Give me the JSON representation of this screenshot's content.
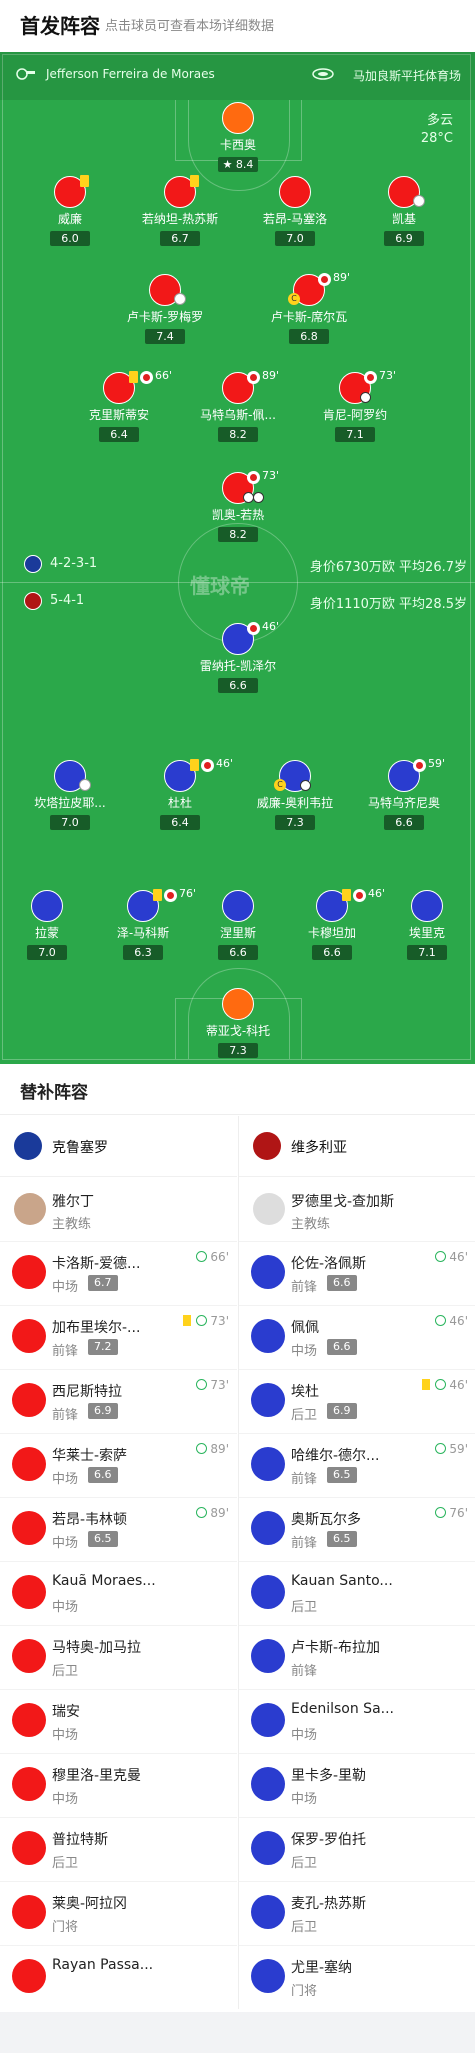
{
  "header": {
    "title": "首发阵容",
    "subtitle": "点击球员可查看本场详细数据"
  },
  "pitch": {
    "referee": "Jefferson Ferreira de Moraes",
    "venue": "马加良斯平托体育场",
    "weather": "多云",
    "temperature": "28°C",
    "watermark": "懂球帝"
  },
  "home_lineup": {
    "gk": {
      "name": "卡西奥",
      "rating": "8.4"
    },
    "def": [
      {
        "name": "威廉",
        "rating": "6.0"
      },
      {
        "name": "若纳坦-热苏斯",
        "rating": "6.7"
      },
      {
        "name": "若昂-马塞洛",
        "rating": "7.0"
      },
      {
        "name": "凯基",
        "rating": "6.9"
      }
    ],
    "dm": [
      {
        "name": "卢卡斯-罗梅罗",
        "rating": "7.4"
      },
      {
        "name": "卢卡斯-席尔瓦",
        "rating": "6.8",
        "sub": "89'"
      }
    ],
    "am": [
      {
        "name": "克里斯蒂安",
        "rating": "6.4",
        "sub": "66'"
      },
      {
        "name": "马特乌斯-佩...",
        "rating": "8.2",
        "sub": "89'"
      },
      {
        "name": "肯尼-阿罗约",
        "rating": "7.1",
        "sub": "73'"
      }
    ],
    "st": {
      "name": "凯奥-若热",
      "rating": "8.2",
      "sub": "73'"
    },
    "formation": "4-2-3-1",
    "value": "身价6730万欧 平均26.7岁"
  },
  "away_lineup": {
    "formation": "5-4-1",
    "value": "身价1110万欧 平均28.5岁",
    "st": {
      "name": "雷纳托-凯泽尔",
      "rating": "6.6",
      "sub": "46'"
    },
    "mid": [
      {
        "name": "坎塔拉皮耶...",
        "rating": "7.0"
      },
      {
        "name": "杜杜",
        "rating": "6.4",
        "sub": "46'"
      },
      {
        "name": "威廉-奥利韦拉",
        "rating": "7.3"
      },
      {
        "name": "马特乌齐尼奥",
        "rating": "6.6",
        "sub": "59'"
      }
    ],
    "def": [
      {
        "name": "拉蒙",
        "rating": "7.0"
      },
      {
        "name": "泽-马科斯",
        "rating": "6.3",
        "sub": "76'"
      },
      {
        "name": "涅里斯",
        "rating": "6.6"
      },
      {
        "name": "卡穆坦加",
        "rating": "6.6",
        "sub": "46'"
      },
      {
        "name": "埃里克",
        "rating": "7.1"
      }
    ],
    "gk": {
      "name": "蒂亚戈-科托",
      "rating": "7.3"
    }
  },
  "subs": {
    "title": "替补阵容",
    "home": {
      "team": "克鲁塞罗",
      "coach": "雅尔丁",
      "coach_role": "主教练",
      "colors": {
        "dot": "#f21818"
      },
      "players": [
        {
          "name": "卡洛斯-爱德...",
          "pos": "中场",
          "rating": "6.7",
          "time": "66'"
        },
        {
          "name": "加布里埃尔-...",
          "pos": "前锋",
          "rating": "7.2",
          "time": "73'",
          "yc": true
        },
        {
          "name": "西尼斯特拉",
          "pos": "前锋",
          "rating": "6.9",
          "time": "73'"
        },
        {
          "name": "华莱士-索萨",
          "pos": "中场",
          "rating": "6.6",
          "time": "89'"
        },
        {
          "name": "若昂-韦林顿",
          "pos": "中场",
          "rating": "6.5",
          "time": "89'"
        },
        {
          "name": "Kauã Moraes...",
          "pos": "中场"
        },
        {
          "name": "马特奥-加马拉",
          "pos": "后卫"
        },
        {
          "name": "瑞安",
          "pos": "中场"
        },
        {
          "name": "穆里洛-里克曼",
          "pos": "中场"
        },
        {
          "name": "普拉特斯",
          "pos": "后卫"
        },
        {
          "name": "莱奥-阿拉冈",
          "pos": "门将"
        },
        {
          "name": "Rayan Passa...",
          "pos": ""
        }
      ]
    },
    "away": {
      "team": "维多利亚",
      "coach": "罗德里戈-查加斯",
      "coach_role": "主教练",
      "colors": {
        "dot": "#2a3ccf"
      },
      "players": [
        {
          "name": "伦佐-洛佩斯",
          "pos": "前锋",
          "rating": "6.6",
          "time": "46'"
        },
        {
          "name": "佩佩",
          "pos": "中场",
          "rating": "6.6",
          "time": "46'"
        },
        {
          "name": "埃杜",
          "pos": "后卫",
          "rating": "6.9",
          "time": "46'",
          "yc": true
        },
        {
          "name": "哈维尔-德尔...",
          "pos": "前锋",
          "rating": "6.5",
          "time": "59'"
        },
        {
          "name": "奥斯瓦尔多",
          "pos": "前锋",
          "rating": "6.5",
          "time": "76'"
        },
        {
          "name": "Kauan Santo...",
          "pos": "后卫"
        },
        {
          "name": "卢卡斯-布拉加",
          "pos": "前锋"
        },
        {
          "name": "Edenilson Sa...",
          "pos": "中场"
        },
        {
          "name": "里卡多-里勒",
          "pos": "中场"
        },
        {
          "name": "保罗-罗伯托",
          "pos": "后卫"
        },
        {
          "name": "麦孔-热苏斯",
          "pos": "后卫"
        },
        {
          "name": "尤里-塞纳",
          "pos": "门将"
        }
      ]
    }
  }
}
